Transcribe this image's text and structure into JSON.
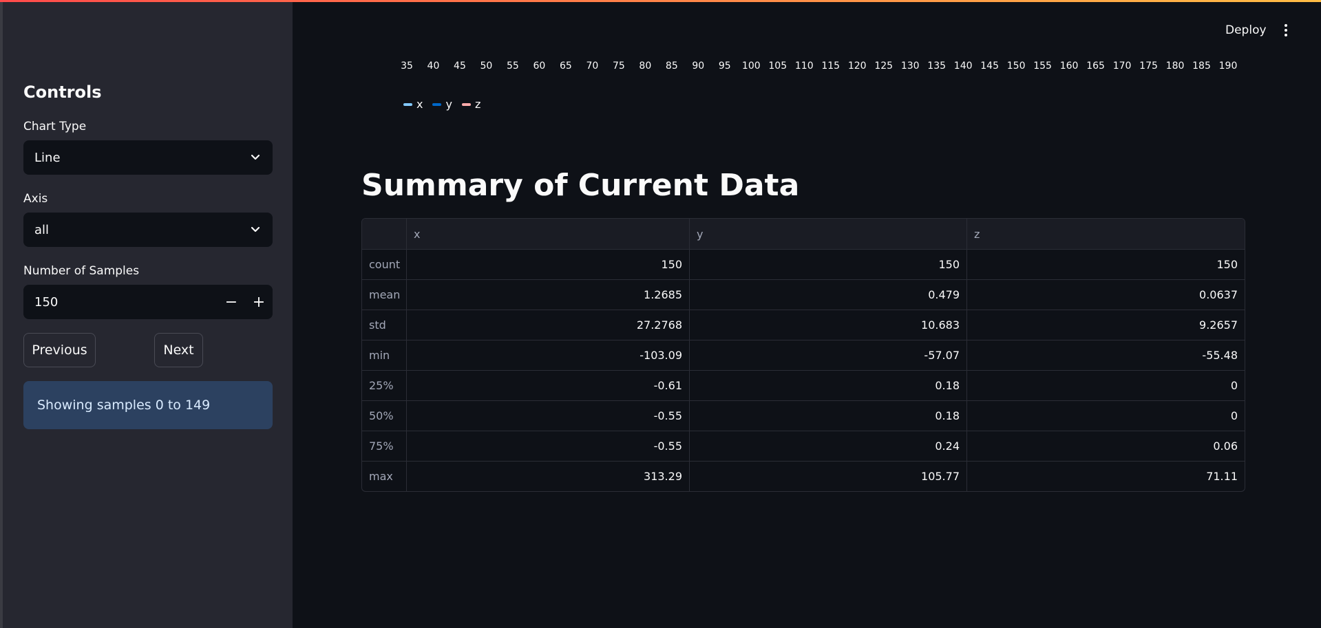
{
  "sidebar": {
    "title": "Controls",
    "chart_type": {
      "label": "Chart Type",
      "value": "Line"
    },
    "axis": {
      "label": "Axis",
      "value": "all"
    },
    "samples": {
      "label": "Number of Samples",
      "value": "150",
      "minus": "−",
      "plus": "+"
    },
    "previous_label": "Previous",
    "next_label": "Next",
    "info": "Showing samples 0 to 149"
  },
  "header": {
    "deploy_label": "Deploy"
  },
  "chart": {
    "x_ticks": [
      "35",
      "40",
      "45",
      "50",
      "55",
      "60",
      "65",
      "70",
      "75",
      "80",
      "85",
      "90",
      "95",
      "100",
      "105",
      "110",
      "115",
      "120",
      "125",
      "130",
      "135",
      "140",
      "145",
      "150",
      "155",
      "160",
      "165",
      "170",
      "175",
      "180",
      "185",
      "190"
    ],
    "legend": [
      {
        "name": "x",
        "color": "#83c9ff"
      },
      {
        "name": "y",
        "color": "#0068c9"
      },
      {
        "name": "z",
        "color": "#ffabab"
      }
    ]
  },
  "main": {
    "title": "Summary of Current Data",
    "table": {
      "columns": [
        "",
        "x",
        "y",
        "z"
      ],
      "rows": [
        [
          "count",
          "150",
          "150",
          "150"
        ],
        [
          "mean",
          "1.2685",
          "0.479",
          "0.0637"
        ],
        [
          "std",
          "27.2768",
          "10.683",
          "9.2657"
        ],
        [
          "min",
          "-103.09",
          "-57.07",
          "-55.48"
        ],
        [
          "25%",
          "-0.61",
          "0.18",
          "0"
        ],
        [
          "50%",
          "-0.55",
          "0.18",
          "0"
        ],
        [
          "75%",
          "-0.55",
          "0.24",
          "0.06"
        ],
        [
          "max",
          "313.29",
          "105.77",
          "71.11"
        ]
      ]
    }
  }
}
